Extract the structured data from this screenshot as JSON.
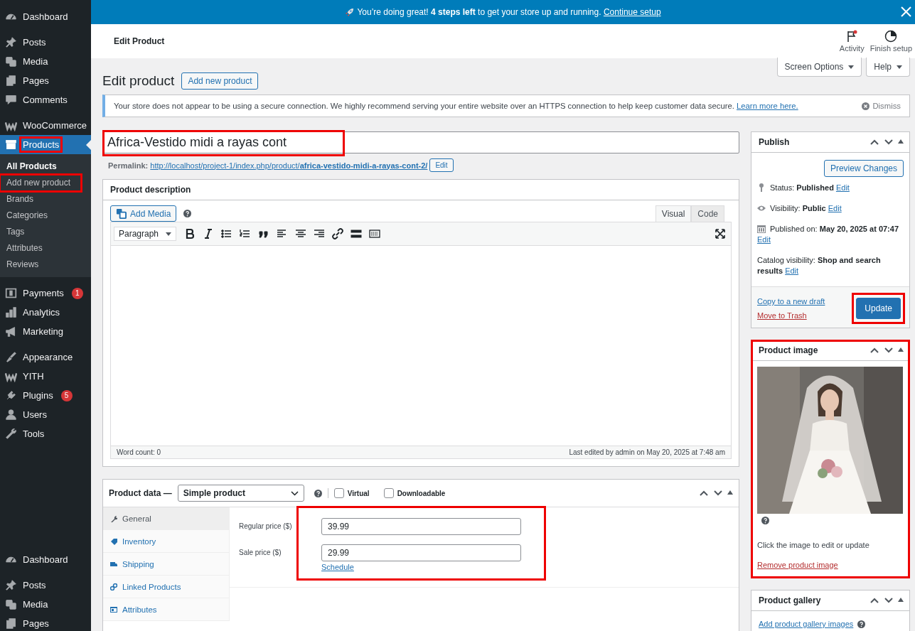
{
  "sidebar": {
    "menus": [
      {
        "groups": [
          [
            {
              "label": "Dashboard",
              "selected": false,
              "highlighted": false
            }
          ],
          [
            {
              "label": "Posts",
              "selected": false,
              "highlighted": false
            },
            {
              "label": "Media",
              "selected": false,
              "highlighted": false
            },
            {
              "label": "Pages",
              "selected": false,
              "highlighted": false
            },
            {
              "label": "Comments",
              "selected": false,
              "highlighted": false
            }
          ],
          [
            {
              "label": "WooCommerce",
              "selected": false,
              "highlighted": false
            },
            {
              "label": "Products",
              "selected": true,
              "highlighted": true,
              "children": [
                {
                  "label": "All Products",
                  "selected": true,
                  "highlighted": false
                },
                {
                  "label": "Add new product",
                  "selected": false,
                  "highlighted": true
                },
                {
                  "label": "Brands",
                  "selected": false,
                  "highlighted": false
                },
                {
                  "label": "Categories",
                  "selected": false,
                  "highlighted": false
                },
                {
                  "label": "Tags",
                  "selected": false,
                  "highlighted": false
                },
                {
                  "label": "Attributes",
                  "selected": false,
                  "highlighted": false
                },
                {
                  "label": "Reviews",
                  "selected": false,
                  "highlighted": false
                }
              ]
            }
          ],
          [
            {
              "label": "Payments",
              "selected": false,
              "highlighted": false,
              "badge": "1"
            },
            {
              "label": "Analytics",
              "selected": false,
              "highlighted": false
            },
            {
              "label": "Marketing",
              "selected": false,
              "highlighted": false
            }
          ],
          [
            {
              "label": "Appearance",
              "selected": false,
              "highlighted": false
            },
            {
              "label": "YITH",
              "selected": false,
              "highlighted": false
            },
            {
              "label": "Plugins",
              "selected": false,
              "highlighted": false,
              "badge": "5"
            },
            {
              "label": "Users",
              "selected": false,
              "highlighted": false
            },
            {
              "label": "Tools",
              "selected": false,
              "highlighted": false
            }
          ]
        ]
      },
      {
        "groups": [
          [
            {
              "label": "Dashboard",
              "selected": false,
              "highlighted": false
            }
          ],
          [
            {
              "label": "Posts",
              "selected": false,
              "highlighted": false
            },
            {
              "label": "Media",
              "selected": false,
              "highlighted": false
            },
            {
              "label": "Pages",
              "selected": false,
              "highlighted": false
            }
          ]
        ]
      }
    ]
  },
  "banner": {
    "text": "You’re doing great! **4 steps left** to get your store up and running.",
    "link": "Continue setup"
  },
  "header": {
    "title": "Edit Product",
    "actions": [
      {
        "label": "Activity",
        "unread": true
      },
      {
        "label": "Finish setup",
        "unread": false
      }
    ]
  },
  "screen_buttons": [
    "Screen Options",
    "Help"
  ],
  "heading": {
    "title": "Edit product",
    "button": "Add new product"
  },
  "notice": {
    "text": "Your store does not appear to be using a secure connection. We highly recommend serving your entire website over an HTTPS connection to help keep customer data secure.",
    "link": "Learn more here.",
    "dismiss": "Dismiss"
  },
  "title_field": {
    "value": "Africa-Vestido midi a rayas cont",
    "highlighted": true
  },
  "permalink": {
    "label": "Permalink:",
    "url": "http://localhost/project-1/index.php/product/**africa-vestido-midi-a-rayas-cont-2/**",
    "button": "Edit"
  },
  "description": {
    "title": "Product description",
    "add_media": "Add Media",
    "tabs": [
      {
        "label": "Visual",
        "selected": true
      },
      {
        "label": "Code",
        "selected": false
      }
    ],
    "format": "Paragraph",
    "word_count": "Word count: 0",
    "last_edited": "Last edited by admin on May 20, 2025 at 7:48 am"
  },
  "product_data": {
    "title": "Product data —",
    "type": "Simple product",
    "options": [
      {
        "label": "Virtual",
        "checked": false
      },
      {
        "label": "Downloadable",
        "checked": false
      }
    ],
    "tabs": [
      {
        "label": "General",
        "selected": true
      },
      {
        "label": "Inventory",
        "selected": false
      },
      {
        "label": "Shipping",
        "selected": false
      },
      {
        "label": "Linked Products",
        "selected": false
      },
      {
        "label": "Attributes",
        "selected": false
      }
    ],
    "fields_highlighted": true,
    "fields": [
      {
        "label": "Regular price ($)",
        "value": "39.99"
      },
      {
        "label": "Sale price ($)",
        "value": "29.99"
      }
    ],
    "schedule": "Schedule"
  },
  "publish": {
    "title": "Publish",
    "preview": "Preview Changes",
    "rows": [
      {
        "text": "Status: **Published**",
        "link": "Edit"
      },
      {
        "text": "Visibility: **Public**",
        "link": "Edit"
      },
      {
        "text": "Published on: **May 20, 2025 at 07:47**",
        "link": "Edit"
      },
      {
        "text": "Catalog visibility: **Shop and search results**",
        "link": "Edit"
      }
    ],
    "copy": "Copy to a new draft",
    "trash": "Move to Trash",
    "update": "Update",
    "update_highlighted": true
  },
  "product_image": {
    "title": "Product image",
    "highlighted": true,
    "hint": "Click the image to edit or update",
    "remove": "Remove product image"
  },
  "product_gallery": {
    "title": "Product gallery",
    "link": "Add product gallery images"
  }
}
